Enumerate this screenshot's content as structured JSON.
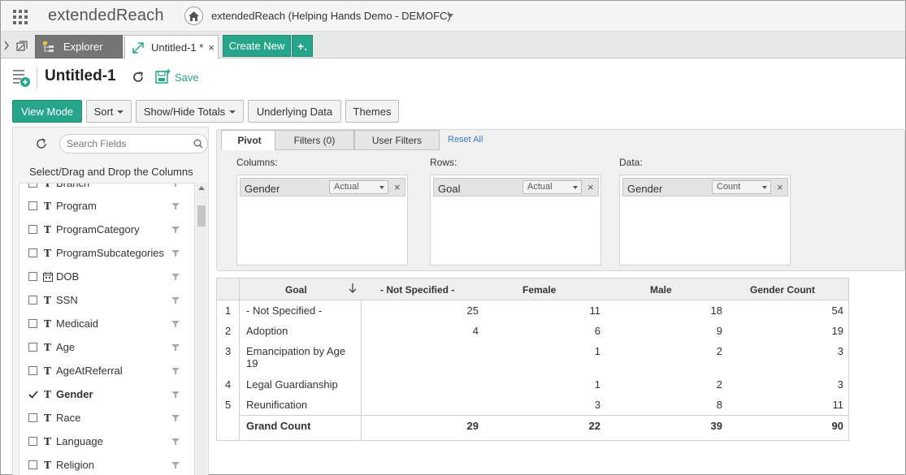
{
  "app": {
    "brand": "extendedReach",
    "org_title": "extendedReach (Helping Hands Demo - DEMOFC)"
  },
  "tabs": {
    "explorer_label": "Explorer",
    "untitled_label": "Untitled-1 *",
    "close_glyph": "×",
    "create_new_label": "Create New",
    "create_plus_label": "+."
  },
  "report": {
    "title": "Untitled-1",
    "save_label": "Save"
  },
  "toolbar": {
    "view_mode": "View Mode",
    "sort": "Sort",
    "show_hide_totals": "Show/Hide Totals",
    "underlying_data": "Underlying Data",
    "themes": "Themes"
  },
  "fields_panel": {
    "search_placeholder": "Search Fields",
    "instructions": "Select/Drag and Drop the Columns",
    "items": [
      {
        "type": "T",
        "label": "Branch",
        "checked": false
      },
      {
        "type": "T",
        "label": "Program",
        "checked": false
      },
      {
        "type": "T",
        "label": "ProgramCategory",
        "checked": false
      },
      {
        "type": "T",
        "label": "ProgramSubcategories",
        "checked": false
      },
      {
        "type": "calendar",
        "label": "DOB",
        "checked": false
      },
      {
        "type": "T",
        "label": "SSN",
        "checked": false
      },
      {
        "type": "T",
        "label": "Medicaid",
        "checked": false
      },
      {
        "type": "T",
        "label": "Age",
        "checked": false
      },
      {
        "type": "T",
        "label": "AgeAtReferral",
        "checked": false
      },
      {
        "type": "T",
        "label": "Gender",
        "checked": true
      },
      {
        "type": "T",
        "label": "Race",
        "checked": false
      },
      {
        "type": "T",
        "label": "Language",
        "checked": false
      },
      {
        "type": "T",
        "label": "Religion",
        "checked": false
      }
    ]
  },
  "pivot_config": {
    "tabs": [
      "Pivot",
      "Filters (0)",
      "User Filters"
    ],
    "reset_all": "Reset All",
    "columns": {
      "label": "Columns:",
      "field": "Gender",
      "option": "Actual"
    },
    "rows": {
      "label": "Rows:",
      "field": "Goal",
      "option": "Actual"
    },
    "data": {
      "label": "Data:",
      "field": "Gender",
      "option": "Count"
    },
    "remove_glyph": "×"
  },
  "pivot_table": {
    "headers": [
      "Goal",
      "- Not Specified -",
      "Female",
      "Male",
      "Gender Count"
    ],
    "rows": [
      {
        "index": "1",
        "goal": "- Not Specified -",
        "values": [
          "25",
          "11",
          "18",
          "54"
        ]
      },
      {
        "index": "2",
        "goal": "Adoption",
        "values": [
          "4",
          "6",
          "9",
          "19"
        ]
      },
      {
        "index": "3",
        "goal": "Emancipation by Age 19",
        "values": [
          "",
          "1",
          "2",
          "3"
        ]
      },
      {
        "index": "4",
        "goal": "Legal Guardianship",
        "values": [
          "",
          "1",
          "2",
          "3"
        ]
      },
      {
        "index": "5",
        "goal": "Reunification",
        "values": [
          "",
          "3",
          "8",
          "11"
        ]
      }
    ],
    "total": {
      "label": "Grand Count",
      "values": [
        "29",
        "22",
        "39",
        "90"
      ]
    }
  },
  "colors": {
    "accent": "#27a58a",
    "link": "#3a7bbf"
  }
}
